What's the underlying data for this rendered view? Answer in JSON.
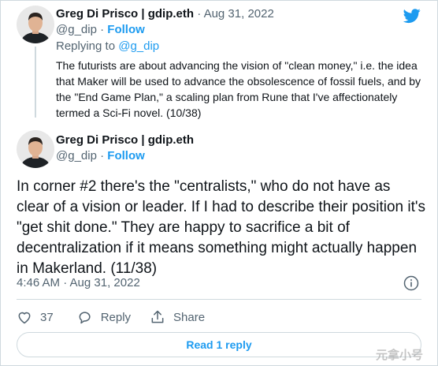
{
  "tweet1": {
    "author_name": "Greg Di Prisco | gdip.eth",
    "date_sep": " · ",
    "date": "Aug 31, 2022",
    "handle": "@g_dip",
    "handle_sep": " · ",
    "follow_label": "Follow",
    "replying_prefix": "Replying to ",
    "replying_handle": "@g_dip",
    "text": "The futurists are about advancing the vision of \"clean money,\" i.e. the idea that Maker will be used to advance the obsolescence of fossil fuels, and by the \"End Game Plan,\" a scaling plan from Rune that I've affectionately termed a Sci-Fi novel. (10/38)"
  },
  "tweet2": {
    "author_name": "Greg Di Prisco | gdip.eth",
    "handle": "@g_dip",
    "handle_sep": " · ",
    "follow_label": "Follow",
    "text": "In corner #2 there's the \"centralists,\" who do not have as clear of a vision or leader. If I had to describe their position it's \"get shit done.\" They are happy to sacrifice a bit of decentralization if it means something might actually happen in Makerland.  (11/38)",
    "timestamp": "4:46 AM · Aug 31, 2022"
  },
  "actions": {
    "like_count": "37",
    "reply_label": "Reply",
    "share_label": "Share"
  },
  "read_replies_label": "Read 1 reply",
  "watermark": "元拿小号",
  "icons": {
    "brand": "twitter-bird-icon",
    "info": "info-icon",
    "like": "heart-icon",
    "reply": "speech-bubble-icon",
    "share": "share-upload-icon"
  },
  "colors": {
    "accent": "#1d9bf0",
    "secondary_text": "#536471",
    "border": "#cfd9de"
  }
}
